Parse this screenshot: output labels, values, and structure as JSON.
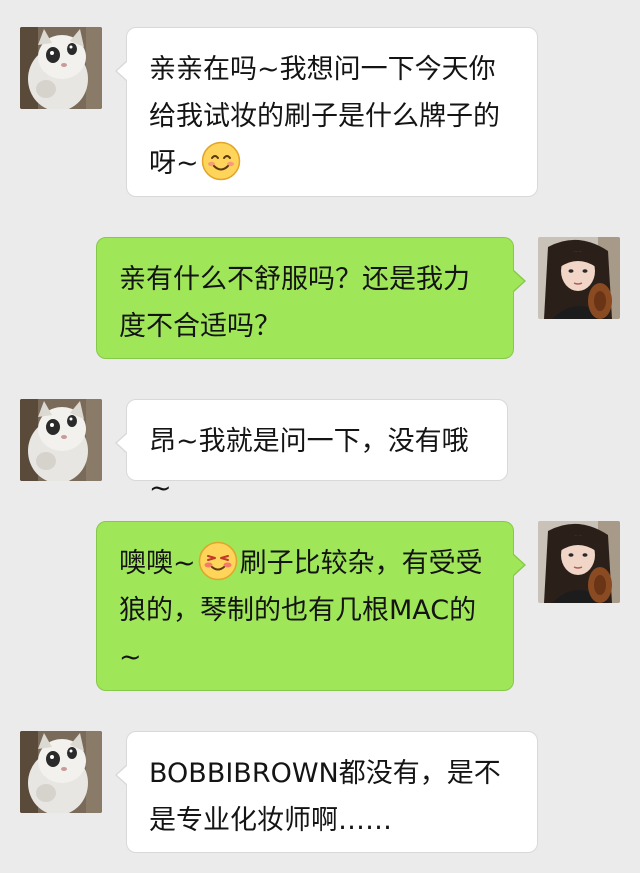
{
  "messages": [
    {
      "sender": "customer",
      "text_a": "亲亲在吗~我想问一下今天你给我试妆的刷子是什么牌子的呀~",
      "emoji": "smiling-face-icon"
    },
    {
      "sender": "me",
      "text_a": "亲有什么不舒服吗？还是我力度不合适吗？"
    },
    {
      "sender": "customer",
      "text_a": "昂~我就是问一下，没有哦~"
    },
    {
      "sender": "me",
      "text_a": "噢噢~",
      "emoji": "blushing-smile-icon",
      "text_b": "刷子比较杂，有受受狼的，琴制的也有几根MAC的~"
    },
    {
      "sender": "customer",
      "text_a": "BOBBIBROWN都没有，是不是专业化妆师啊……"
    }
  ],
  "colors": {
    "background": "#ebebeb",
    "incoming_bubble": "#ffffff",
    "outgoing_bubble": "#9fe658",
    "text": "#141414"
  }
}
